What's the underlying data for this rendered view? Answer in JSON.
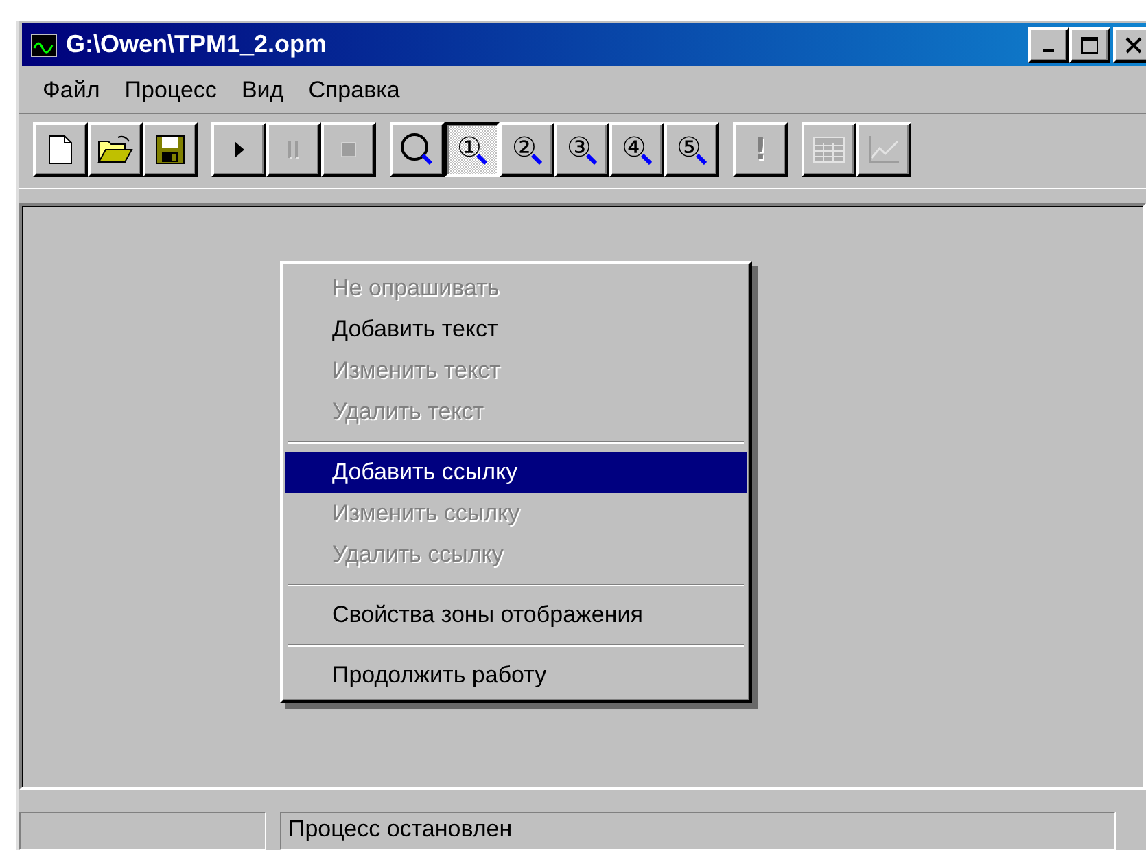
{
  "window": {
    "title": "G:\\Owen\\TPM1_2.opm"
  },
  "menu": [
    {
      "label": "Файл"
    },
    {
      "label": "Процесс"
    },
    {
      "label": "Вид"
    },
    {
      "label": "Справка"
    }
  ],
  "toolbar": [
    [
      {
        "kind": "new",
        "disabled": false,
        "pressed": false
      },
      {
        "kind": "open",
        "disabled": false,
        "pressed": false
      },
      {
        "kind": "save",
        "disabled": false,
        "pressed": false
      }
    ],
    [
      {
        "kind": "play",
        "disabled": false,
        "pressed": false
      },
      {
        "kind": "pause",
        "disabled": true,
        "pressed": false
      },
      {
        "kind": "stop",
        "disabled": true,
        "pressed": false
      }
    ],
    [
      {
        "kind": "zoom",
        "disabled": false,
        "pressed": false
      },
      {
        "kind": "zoom",
        "label": "①",
        "disabled": false,
        "pressed": true
      },
      {
        "kind": "zoom",
        "label": "②",
        "disabled": false,
        "pressed": false
      },
      {
        "kind": "zoom",
        "label": "③",
        "disabled": false,
        "pressed": false
      },
      {
        "kind": "zoom",
        "label": "④",
        "disabled": false,
        "pressed": false
      },
      {
        "kind": "zoom",
        "label": "⑤",
        "disabled": false,
        "pressed": false
      }
    ],
    [
      {
        "kind": "text",
        "label": "!",
        "disabled": true,
        "pressed": false
      }
    ],
    [
      {
        "kind": "table",
        "disabled": true,
        "pressed": false
      },
      {
        "kind": "chart",
        "disabled": true,
        "pressed": false
      }
    ]
  ],
  "context_menu": [
    {
      "kind": "item",
      "label": "Не опрашивать",
      "disabled": true,
      "selected": false
    },
    {
      "kind": "item",
      "label": "Добавить текст",
      "disabled": false,
      "selected": false
    },
    {
      "kind": "item",
      "label": "Изменить текст",
      "disabled": true,
      "selected": false
    },
    {
      "kind": "item",
      "label": "Удалить текст",
      "disabled": true,
      "selected": false
    },
    {
      "kind": "separator"
    },
    {
      "kind": "item",
      "label": "Добавить ссылку",
      "disabled": false,
      "selected": true
    },
    {
      "kind": "item",
      "label": "Изменить ссылку",
      "disabled": true,
      "selected": false
    },
    {
      "kind": "item",
      "label": "Удалить ссылку",
      "disabled": true,
      "selected": false
    },
    {
      "kind": "separator"
    },
    {
      "kind": "item",
      "label": "Свойства зоны отображения",
      "disabled": false,
      "selected": false
    },
    {
      "kind": "separator"
    },
    {
      "kind": "item",
      "label": "Продолжить работу",
      "disabled": false,
      "selected": false
    }
  ],
  "status_bar": {
    "message": "Процесс остановлен"
  }
}
